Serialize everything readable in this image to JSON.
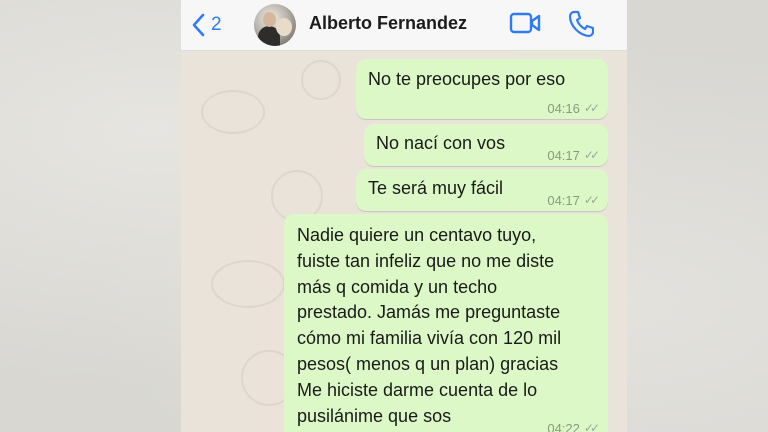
{
  "header": {
    "back_count": "2",
    "contact_name": "Alberto Fernandez",
    "icons": [
      "chevron-left-icon",
      "video-call-icon",
      "phone-call-icon"
    ]
  },
  "messages": [
    {
      "text": "No te preocupes por eso",
      "time": "04:16",
      "status": "read"
    },
    {
      "text": "No nací con vos",
      "time": "04:17",
      "status": "read"
    },
    {
      "text": "Te será muy fácil",
      "time": "04:17",
      "status": "read"
    },
    {
      "lines": [
        "Nadie quiere un centavo tuyo,",
        "fuiste tan infeliz que no me diste",
        "más q comida y un techo",
        "prestado. Jamás me preguntaste",
        "cómo mi familia vivía con 120 mil",
        "pesos( menos q un plan) gracias",
        "Me hiciste darme cuenta de lo",
        "pusilánime que sos"
      ],
      "time": "04:22",
      "status": "read"
    }
  ],
  "colors": {
    "outgoing_bubble": "#dcf8c6",
    "header_bg": "#f7f7f7",
    "accent": "#2f7bf6",
    "chat_bg": "#e9e3d9"
  }
}
